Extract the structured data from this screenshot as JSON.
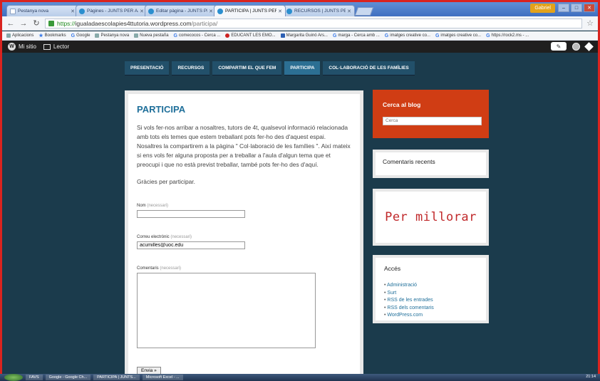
{
  "browser": {
    "tabs": [
      {
        "label": "Pestanya nova",
        "icon": "doc",
        "active": false
      },
      {
        "label": "Pàgines - JUNTS PER AJUD",
        "icon": "wp",
        "active": false
      },
      {
        "label": "Editar pàgina - JUNTS PER",
        "icon": "wp",
        "active": false
      },
      {
        "label": "PARTICIPA | JUNTS PER A",
        "icon": "wp",
        "active": true
      },
      {
        "label": "RECURSOS | JUNTS PER A",
        "icon": "wp",
        "active": false
      }
    ],
    "user": "Gabriel",
    "url_secure": "https://",
    "url_host": "igualadaescolapies4ttutoria.wordpress.com",
    "url_path": "/participa/",
    "bookmarks": [
      "Aplicacions",
      "Bookmarks",
      "Google",
      "Pestanya nova",
      "Nueva pestaña",
      "comecocos - Cerca ...",
      "EDUCANT LES EMO...",
      "Margarita Guinó Ars...",
      "marga - Cerca amb ...",
      "imatges creative co...",
      "imatges creative co...",
      "https://rock2.ms - ..."
    ]
  },
  "wpbar": {
    "my_site": "Mi sitio",
    "reader": "Lector"
  },
  "nav": {
    "items": [
      "PRESENTACIÓ",
      "RECURSOS",
      "COMPARTIM EL QUE FEM",
      "PARTICIPA",
      "COL·LABORACIÓ DE LES FAMÍLIES"
    ],
    "current": 3
  },
  "page": {
    "title": "PARTICIPA",
    "body": "Si vols fer-nos arribar a nosaltres, tutors de 4t, qualsevol informació relacionada amb tots els temes que estem treballant pots fer-ho des d'aquest espai. Nosaltres la compartirem a la pàgina \" Col·laboració de les famílies \". Així mateix si ens vols fer alguna proposta per a treballar a l'aula d'algun tema que et preocupi i que no està previst treballar, també pots fer-ho des d'aquí.",
    "thanks": "Gràcies per participar."
  },
  "form": {
    "name_label": "Nom",
    "required": "(necessari)",
    "name_value": "",
    "email_label": "Correu electrònic",
    "email_value": "acumilles@uoc.edu",
    "comment_label": "Comentaris",
    "submit": "Envia »"
  },
  "sidebar": {
    "search_title": "Cerca al blog",
    "search_placeholder": "Cerca",
    "recent_title": "Comentaris recents",
    "improve_image_text": "Per millorar",
    "access_title": "Accés",
    "access_links": [
      "Administració",
      "Surt",
      "RSS de les entrades",
      "RSS dels comentaris",
      "WordPress.com"
    ]
  },
  "taskbar": {
    "items": [
      "FAVS",
      "Google - Google Ch...",
      "PARTICIPA | JUNTS...",
      "Microsoft Excel - ..."
    ],
    "clock": "21:14"
  },
  "colors": {
    "page_bg": "#1b3b4c",
    "title_blue": "#1f6f9a",
    "search_widget": "#d03d14",
    "frame_red": "#d9231f"
  }
}
